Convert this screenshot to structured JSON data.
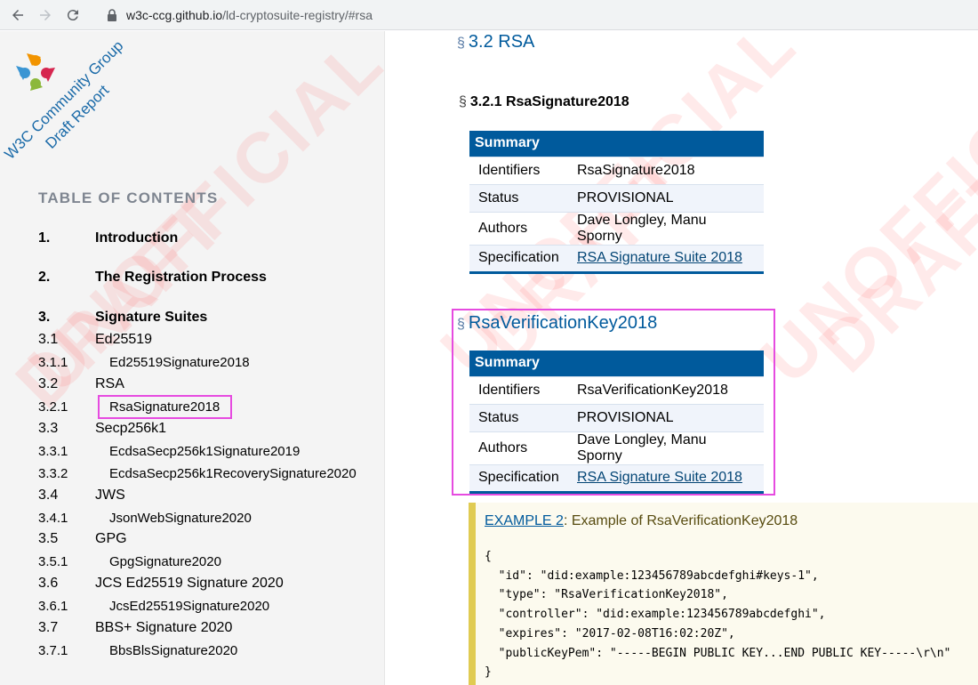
{
  "browser": {
    "url_host": "w3c-ccg.github.io",
    "url_path": "/ld-cryptosuite-registry/#rsa"
  },
  "logo": {
    "text_line1": "W3C Community Group",
    "text_line2": "Draft Report"
  },
  "watermark": {
    "line1": "UNOFFICIAL",
    "line2": "DRAFT"
  },
  "toc": {
    "title": "TABLE OF CONTENTS",
    "items": [
      {
        "num": "1.",
        "label": "Introduction"
      },
      {
        "num": "2.",
        "label": "The Registration Process"
      },
      {
        "num": "3.",
        "label": "Signature Suites"
      },
      {
        "num": "3.1",
        "label": "Ed25519"
      },
      {
        "num": "3.1.1",
        "label": "Ed25519Signature2018"
      },
      {
        "num": "3.2",
        "label": "RSA"
      },
      {
        "num": "3.2.1",
        "label": "RsaSignature2018"
      },
      {
        "num": "3.3",
        "label": "Secp256k1"
      },
      {
        "num": "3.3.1",
        "label": "EcdsaSecp256k1Signature2019"
      },
      {
        "num": "3.3.2",
        "label": "EcdsaSecp256k1RecoverySignature2020"
      },
      {
        "num": "3.4",
        "label": "JWS"
      },
      {
        "num": "3.4.1",
        "label": "JsonWebSignature2020"
      },
      {
        "num": "3.5",
        "label": "GPG"
      },
      {
        "num": "3.5.1",
        "label": "GpgSignature2020"
      },
      {
        "num": "3.6",
        "label": "JCS Ed25519 Signature 2020"
      },
      {
        "num": "3.6.1",
        "label": "JcsEd25519Signature2020"
      },
      {
        "num": "3.7",
        "label": "BBS+ Signature 2020"
      },
      {
        "num": "3.7.1",
        "label": "BbsBlsSignature2020"
      }
    ]
  },
  "main": {
    "section_mark": "§",
    "section_title": "3.2 RSA",
    "subsection_title": "3.2.1 RsaSignature2018",
    "table1": {
      "header": "Summary",
      "rows": [
        {
          "k": "Identifiers",
          "v": "RsaSignature2018"
        },
        {
          "k": "Status",
          "v": "PROVISIONAL"
        },
        {
          "k": "Authors",
          "v": "Dave Longley, Manu Sporny"
        },
        {
          "k": "Specification",
          "v": "RSA Signature Suite 2018"
        }
      ]
    },
    "section2_title": "RsaVerificationKey2018",
    "table2": {
      "header": "Summary",
      "rows": [
        {
          "k": "Identifiers",
          "v": "RsaVerificationKey2018"
        },
        {
          "k": "Status",
          "v": "PROVISIONAL"
        },
        {
          "k": "Authors",
          "v": "Dave Longley, Manu Sporny"
        },
        {
          "k": "Specification",
          "v": "RSA Signature Suite 2018"
        }
      ]
    },
    "example": {
      "link": "EXAMPLE 2",
      "caption": ": Example of RsaVerificationKey2018",
      "code": "{\n  \"id\": \"did:example:123456789abcdefghi#keys-1\",\n  \"type\": \"RsaVerificationKey2018\",\n  \"controller\": \"did:example:123456789abcdefghi\",\n  \"expires\": \"2017-02-08T16:02:20Z\",\n  \"publicKeyPem\": \"-----BEGIN PUBLIC KEY...END PUBLIC KEY-----\\r\\n\"\n}"
    }
  },
  "colors": {
    "w3c_blue": "#005a9c",
    "highlight": "#e64be0",
    "watermark": "#ff5050"
  }
}
